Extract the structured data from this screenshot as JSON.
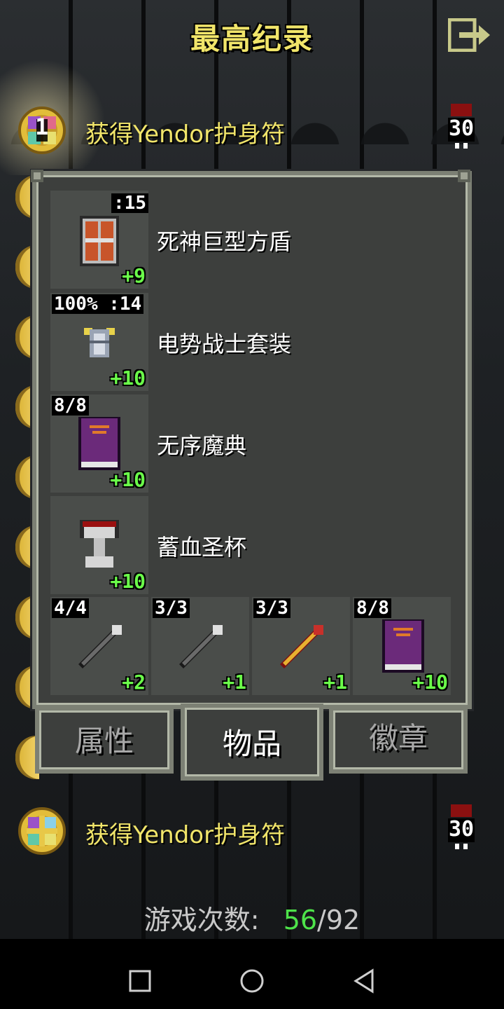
{
  "header": {
    "title": "最高纪录"
  },
  "records": [
    {
      "rank": "1",
      "label": "获得Yendor护身符",
      "depth": "30"
    },
    {
      "rank": "",
      "label": "获得Yendor护身符",
      "depth": "30"
    }
  ],
  "items": [
    {
      "name": "死神巨型方盾",
      "top_tag": ":15",
      "plus": "+9",
      "icon": "shield-icon"
    },
    {
      "name": "电势战士套装",
      "top_tag": "100% :14",
      "plus": "+10",
      "icon": "armor-icon"
    },
    {
      "name": "无序魔典",
      "top_tag": "8/8",
      "plus": "+10",
      "icon": "spellbook-icon"
    },
    {
      "name": "蓄血圣杯",
      "top_tag": "",
      "plus": "+10",
      "icon": "chalice-icon"
    }
  ],
  "quickslots": [
    {
      "tag": "4/4",
      "plus": "+2",
      "icon": "wand-icon"
    },
    {
      "tag": "3/3",
      "plus": "+1",
      "icon": "wand-icon"
    },
    {
      "tag": "3/3",
      "plus": "+1",
      "icon": "staff-icon"
    },
    {
      "tag": "8/8",
      "plus": "+10",
      "icon": "spellbook-icon"
    }
  ],
  "tabs": {
    "stats": "属性",
    "items": "物品",
    "badges": "徽章",
    "active": "items"
  },
  "footer": {
    "games_label": "游戏次数:",
    "games_won": "56",
    "games_total": "/92"
  },
  "colors": {
    "title": "#f1e56a",
    "plus": "#6bff4a",
    "won": "#4ee34a"
  }
}
